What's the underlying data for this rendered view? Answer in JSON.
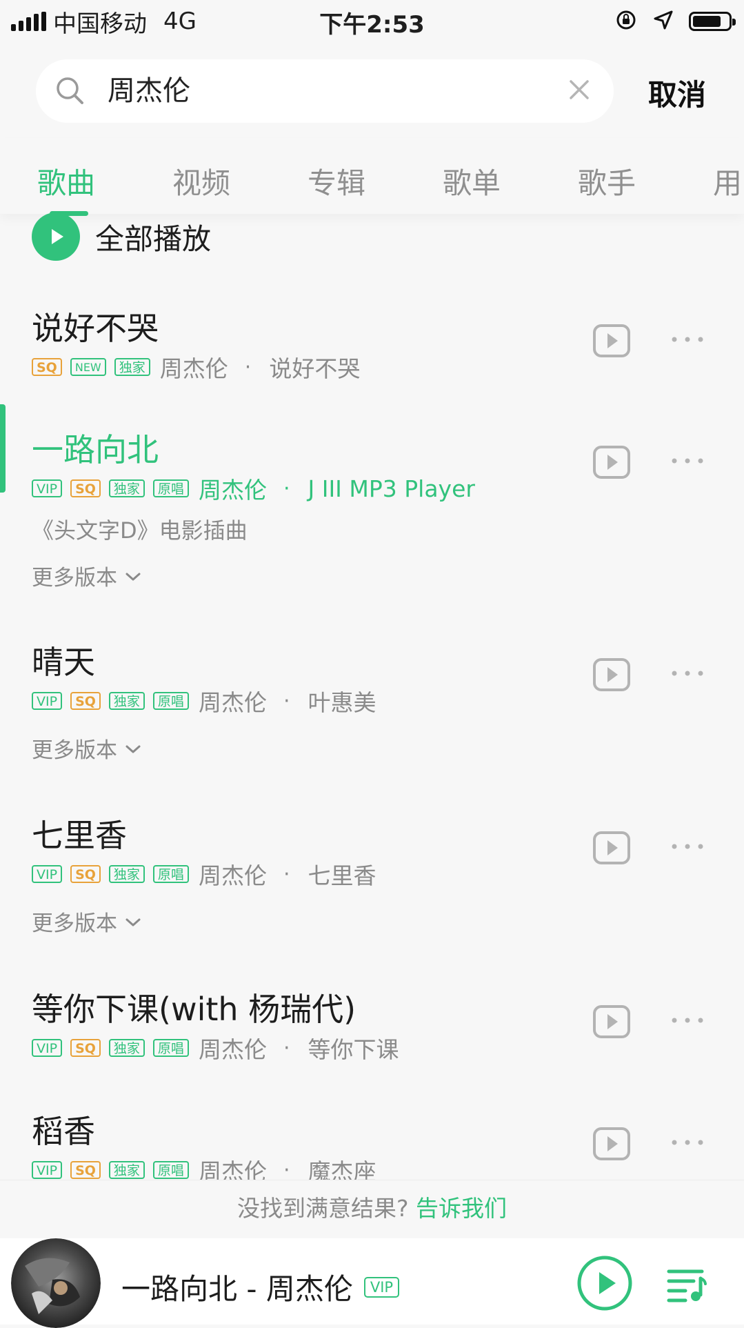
{
  "status_bar": {
    "carrier": "中国移动",
    "network": "4G",
    "time": "下午2:53",
    "battery_level": 0.8
  },
  "search": {
    "query": "周杰伦",
    "cancel_label": "取消"
  },
  "tabs": [
    {
      "label": "歌曲",
      "active": true
    },
    {
      "label": "视频",
      "active": false
    },
    {
      "label": "专辑",
      "active": false
    },
    {
      "label": "歌单",
      "active": false
    },
    {
      "label": "歌手",
      "active": false
    },
    {
      "label": "用",
      "active": false
    }
  ],
  "play_all_label": "全部播放",
  "songs": [
    {
      "title": "说好不哭",
      "tags": [
        "SQ",
        "NEW",
        "独家"
      ],
      "artist": "周杰伦",
      "album": "说好不哭",
      "playing": false
    },
    {
      "title": "一路向北",
      "tags": [
        "VIP",
        "SQ",
        "独家",
        "原唱"
      ],
      "artist": "周杰伦",
      "album": "J III MP3 Player",
      "description": "《头文字D》电影插曲",
      "more_versions": "更多版本",
      "playing": true
    },
    {
      "title": "晴天",
      "tags": [
        "VIP",
        "SQ",
        "独家",
        "原唱"
      ],
      "artist": "周杰伦",
      "album": "叶惠美",
      "more_versions": "更多版本",
      "playing": false
    },
    {
      "title": "七里香",
      "tags": [
        "VIP",
        "SQ",
        "独家",
        "原唱"
      ],
      "artist": "周杰伦",
      "album": "七里香",
      "more_versions": "更多版本",
      "playing": false
    },
    {
      "title": "等你下课(with 杨瑞代)",
      "tags": [
        "VIP",
        "SQ",
        "独家",
        "原唱"
      ],
      "artist": "周杰伦",
      "album": "等你下课",
      "playing": false
    },
    {
      "title": "稻香",
      "tags": [
        "VIP",
        "SQ",
        "独家",
        "原唱"
      ],
      "artist": "周杰伦",
      "album": "魔杰座",
      "playing": false
    }
  ],
  "feedback": {
    "text": "没找到满意结果?",
    "link": "告诉我们"
  },
  "now_playing": {
    "title": "一路向北 - 周杰伦",
    "badge": "VIP"
  },
  "colors": {
    "accent": "#31c27c",
    "sq": "#e8a23a",
    "text": "#1d1d1d",
    "muted": "#8a8a8a",
    "background": "#f7f7f7"
  }
}
